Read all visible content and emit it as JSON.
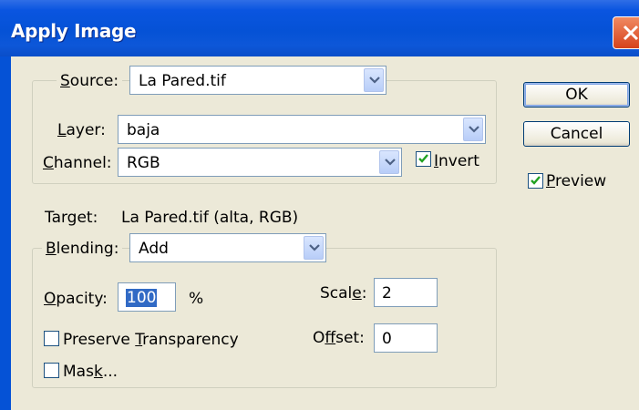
{
  "window": {
    "title": "Apply Image"
  },
  "source": {
    "label": "Source:",
    "label_accel": "S",
    "label_rest": "ource:",
    "value": "La Pared.tif"
  },
  "layer": {
    "label_accel": "L",
    "label_rest": "ayer:",
    "value": "baja"
  },
  "channel": {
    "label_accel": "C",
    "label_rest": "hannel:",
    "value": "RGB",
    "invert": {
      "checked": true,
      "label_accel": "I",
      "label_rest": "nvert"
    }
  },
  "target": {
    "label": "Target:",
    "value": "La Pared.tif (alta, RGB)"
  },
  "blending": {
    "label_accel": "B",
    "label_rest": "lending:",
    "value": "Add",
    "opacity": {
      "label_accel": "O",
      "label_rest": "pacity:",
      "value": "100",
      "unit": "%"
    },
    "scale": {
      "label_pre": "Scal",
      "label_accel": "e",
      "label_post": ":",
      "value": "2"
    },
    "offset": {
      "label_pre": "O",
      "label_accel": "f",
      "label_post": "fset:",
      "value": "0"
    },
    "preserve_transparency": {
      "checked": false,
      "label_pre": "Preserve ",
      "label_accel": "T",
      "label_post": "ransparency"
    },
    "mask": {
      "checked": false,
      "label_pre": "Mas",
      "label_accel": "k",
      "label_post": "..."
    }
  },
  "buttons": {
    "ok": "OK",
    "cancel": "Cancel"
  },
  "preview": {
    "checked": true,
    "label_accel": "P",
    "label_rest": "review"
  },
  "colors": {
    "titlebar": "#0552d6",
    "dialog_bg": "#ece9d8",
    "selection": "#316ac5",
    "close": "#d6421b"
  }
}
